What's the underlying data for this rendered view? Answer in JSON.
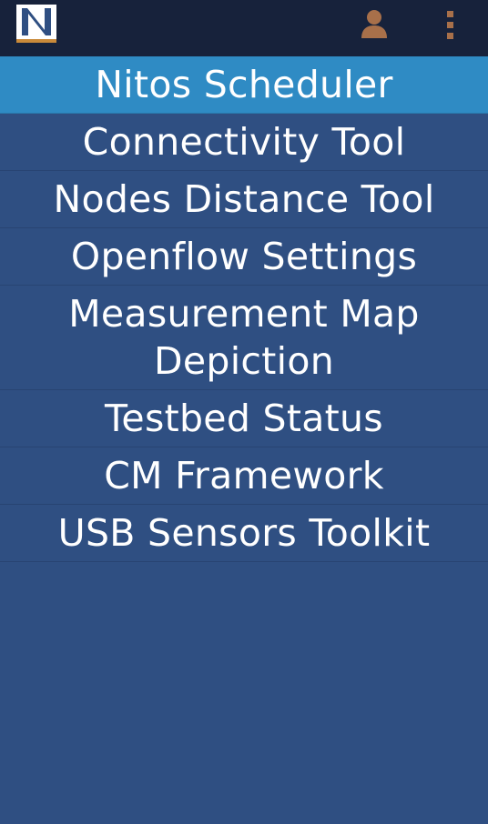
{
  "action_bar": {
    "logo_letter": "N",
    "icons": {
      "user": "user-icon",
      "overflow": "overflow-menu-icon"
    },
    "colors": {
      "background": "#17223b",
      "icon": "#a8704a"
    }
  },
  "menu": {
    "items": [
      {
        "label": "Nitos Scheduler",
        "active": true
      },
      {
        "label": "Connectivity Tool",
        "active": false
      },
      {
        "label": "Nodes Distance Tool",
        "active": false
      },
      {
        "label": "Openflow Settings",
        "active": false
      },
      {
        "label": "Measurement Map Depiction",
        "active": false
      },
      {
        "label": "Testbed Status",
        "active": false
      },
      {
        "label": "CM Framework",
        "active": false
      },
      {
        "label": "USB Sensors Toolkit",
        "active": false
      }
    ],
    "colors": {
      "background": "#2f4f82",
      "active": "#2f8bc4",
      "text": "#ffffff"
    }
  }
}
